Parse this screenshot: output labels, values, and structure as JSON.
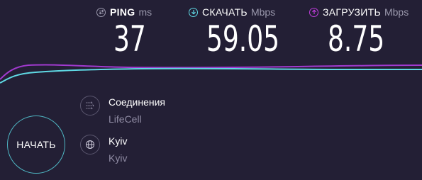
{
  "metrics": {
    "ping": {
      "label": "PING",
      "unit": "ms",
      "value": "37",
      "icon": "ping-icon",
      "color": "#9a98ac"
    },
    "download": {
      "label": "СКАЧАТЬ",
      "unit": "Mbps",
      "value": "59.05",
      "icon": "download-arrow-icon",
      "color": "#5fd9e4"
    },
    "upload": {
      "label": "ЗАГРУЗИТЬ",
      "unit": "Mbps",
      "value": "8.75",
      "icon": "upload-arrow-icon",
      "color": "#c03ddc"
    }
  },
  "start_button": {
    "label": "НАЧАТЬ",
    "color": "#4fb7c4"
  },
  "connection": {
    "title": "Соединения",
    "provider": "LifeCell",
    "icon": "connections-icon"
  },
  "server": {
    "title": "Kyiv",
    "location": "Kyiv",
    "icon": "globe-icon"
  },
  "colors": {
    "background": "#231f35",
    "download_line": "#5fd9e4",
    "upload_line": "#a23ad0"
  }
}
